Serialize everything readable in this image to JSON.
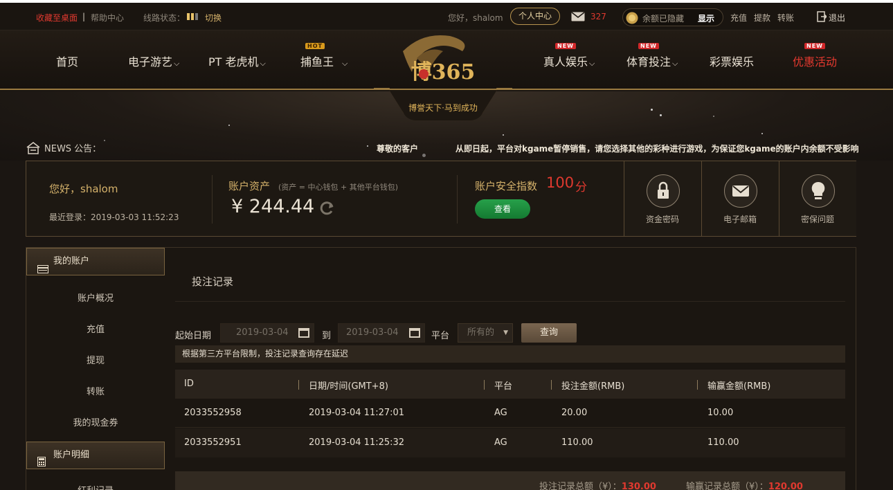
{
  "topbar": {
    "bookmark": "收藏至桌面",
    "separator": "|",
    "help": "帮助中心",
    "route_status_label": "线路状态：",
    "switch": "切换",
    "greeting": "您好，shalom",
    "user_center": "个人中心",
    "mail_count": "327",
    "balance_hidden": "余额已隐藏",
    "show": "显示",
    "recharge": "充值",
    "withdraw": "提款",
    "transfer": "转账",
    "logout": "退出"
  },
  "nav": {
    "home": "首页",
    "egames": "电子游艺",
    "pt_slots": "PT 老虎机",
    "fishing": "捕鱼王",
    "fishing_badge": "HOT",
    "live": "真人娱乐",
    "live_badge": "NEW",
    "sports": "体育投注",
    "sports_badge": "NEW",
    "lottery": "彩票娱乐",
    "promotions": "优惠活动",
    "promotions_badge": "NEW",
    "logo_text": "博365",
    "logo_slogan": "博誉天下·马到成功"
  },
  "news": {
    "label": "NEWS 公告：",
    "title": "尊敬的客户",
    "text": "从即日起，平台对kgame暂停销售，请您选择其他的彩种进行游戏，为保证您kgame的账户内余额不受影响"
  },
  "summary": {
    "greeting": "您好，shalom",
    "last_login": "最近登录：2019-03-03 11:52:23",
    "assets_label": "账户资产",
    "assets_note": "(资产 = 中心钱包 + 其他平台钱包)",
    "assets_value": "¥ 244.44",
    "security_label": "账户安全指数",
    "security_score": "100",
    "security_unit": "分",
    "view_button": "查看",
    "security_items": [
      "资金密码",
      "电子邮箱",
      "密保问题"
    ]
  },
  "sidebar": {
    "my_account": "我的账户",
    "items": [
      "账户概况",
      "充值",
      "提现",
      "转账",
      "我的现金券"
    ],
    "account_details": "账户明细",
    "sub_items": [
      "红利记录"
    ]
  },
  "bets": {
    "title": "投注记录",
    "start_date_label": "起始日期",
    "start_date": "2019-03-04",
    "to_label": "到",
    "end_date": "2019-03-04",
    "platform_label": "平台",
    "platform_value": "所有的",
    "query_button": "查询",
    "notice": "根据第三方平台限制，投注记录查询存在延迟",
    "columns": [
      "ID",
      "日期/时间(GMT+8)",
      "平台",
      "投注金额(RMB)",
      "输赢金额(RMB)"
    ],
    "rows": [
      {
        "id": "2033552958",
        "datetime": "2019-03-04 11:27:01",
        "platform": "AG",
        "bet": "20.00",
        "win": "10.00"
      },
      {
        "id": "2033552951",
        "datetime": "2019-03-04 11:25:32",
        "platform": "AG",
        "bet": "110.00",
        "win": "110.00"
      }
    ],
    "total_bet_label": "投注记录总额（¥）：",
    "total_bet": "130.00",
    "total_win_label": "输赢记录总额（¥）：",
    "total_win": "120.00"
  },
  "colors": {
    "accent_gold": "#d5b26b",
    "alert_red": "#e0392f",
    "success_green": "#1f8f3f"
  }
}
